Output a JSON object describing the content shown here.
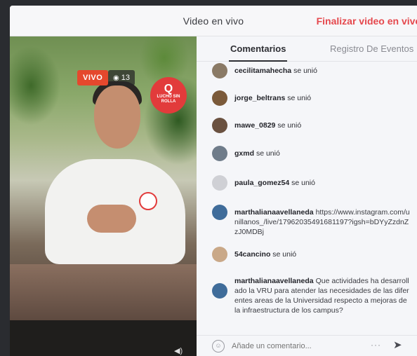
{
  "window": {
    "title": "Video en vivo",
    "end_button": "Finalizar video en vivo"
  },
  "video": {
    "live_badge": "VIVO",
    "viewer_count": "13",
    "brand_logo_text": "LUCHO SIN ROLLA",
    "icons": {
      "viewers": "eye-icon",
      "mute": "speaker-icon"
    }
  },
  "panel": {
    "tabs": [
      {
        "label": "Comentarios",
        "active": true
      },
      {
        "label": "Registro De Eventos",
        "active": false
      }
    ],
    "comments": [
      {
        "user": "cecilitamahecha",
        "text": "se unió",
        "avatar_color": "#8a7a66"
      },
      {
        "user": "jorge_beltrans",
        "text": "se unió",
        "avatar_color": "#7b5a3a"
      },
      {
        "user": "mawe_0829",
        "text": "se unió",
        "avatar_color": "#6a5140"
      },
      {
        "user": "gxmd",
        "text": "se unió",
        "avatar_color": "#6f7c8a"
      },
      {
        "user": "paula_gomez54",
        "text": "se unió",
        "avatar_color": "#cfd0d5"
      },
      {
        "user": "marthalianaavellaneda",
        "text": "https://www.instagram.com/unillanos_/live/17962035491681197?igsh=bDYyZzdnZzJ0MDBj",
        "avatar_color": "#3f6c9a"
      },
      {
        "user": "54cancino",
        "text": "se unió",
        "avatar_color": "#c9a888"
      },
      {
        "user": "marthalianaavellaneda",
        "text": "Que actividades ha desarrollado la VRU para atender las necesidades de las diferentes areas de la Universidad respecto a mejoras de la infraestructura de los campus?",
        "avatar_color": "#3f6c9a"
      }
    ],
    "composer": {
      "placeholder": "Añade un comentario...",
      "more_label": "···",
      "icons": {
        "emoji": "emoji-icon",
        "send": "send-icon"
      }
    }
  }
}
